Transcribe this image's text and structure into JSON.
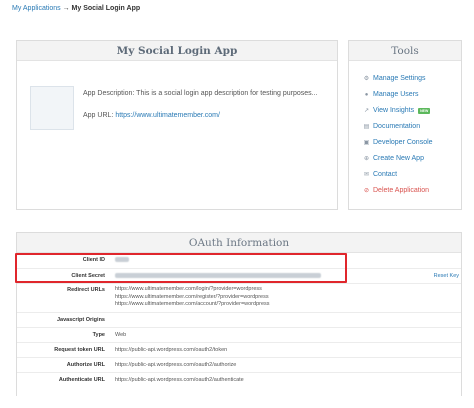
{
  "breadcrumb": {
    "parent": "My Applications",
    "separator": "→",
    "current": "My Social Login App"
  },
  "app": {
    "title": "My Social Login App",
    "description": "App Description: This is a social login app description for testing purposes...",
    "url_label": "App URL:",
    "url": "https://www.ultimatemember.com/"
  },
  "tools": {
    "title": "Tools",
    "items": [
      {
        "label": "Manage Settings",
        "icon": "gear-icon"
      },
      {
        "label": "Manage Users",
        "icon": "users-icon"
      },
      {
        "label": "View Insights",
        "icon": "chart-icon",
        "badge": "NEW"
      },
      {
        "label": "Documentation",
        "icon": "book-icon"
      },
      {
        "label": "Developer Console",
        "icon": "console-icon"
      },
      {
        "label": "Create New App",
        "icon": "plus-icon"
      },
      {
        "label": "Contact",
        "icon": "contact-icon"
      },
      {
        "label": "Delete Application",
        "icon": "trash-icon",
        "danger": true
      }
    ]
  },
  "oauth": {
    "title": "OAuth Information",
    "client_id_label": "Client ID",
    "client_secret_label": "Client Secret",
    "reset_key_label": "Reset Key",
    "redirect_urls_label": "Redirect URLs",
    "redirect_urls": [
      "https://www.ultimatemember.com/login/?provider=wordpress",
      "https://www.ultimatemember.com/register/?provider=wordpress",
      "https://www.ultimatemember.com/account/?provider=wordpress"
    ],
    "javascript_origins_label": "Javascript Origins",
    "type_label": "Type",
    "type_value": "Web",
    "request_token_label": "Request token URL",
    "request_token_value": "https://public-api.wordpress.com/oauth2/token",
    "authorize_label": "Authorize URL",
    "authorize_value": "https://public-api.wordpress.com/oauth2/authorize",
    "authenticate_label": "Authenticate URL",
    "authenticate_value": "https://public-api.wordpress.com/oauth2/authenticate"
  },
  "colors": {
    "link": "#2a7ab5",
    "danger": "#d9534f",
    "highlight": "#e0262c",
    "badge": "#5cb85c"
  }
}
